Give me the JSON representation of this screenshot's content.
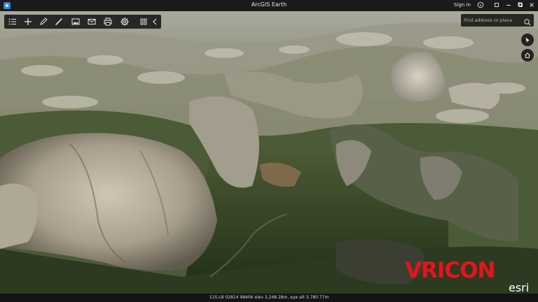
{
  "window": {
    "title": "ArcGIS Earth",
    "sign_in": "Sign in",
    "icons": [
      "help-icon",
      "minimize-icon",
      "maximize-icon",
      "close-icon"
    ]
  },
  "toolbar": {
    "items": [
      "contents-icon",
      "add-icon",
      "draw-icon",
      "measure-icon",
      "screenshot-icon",
      "email-icon",
      "print-icon",
      "settings-icon",
      "basemap-icon",
      "collapse-icon"
    ]
  },
  "search": {
    "placeholder": "Find address or place"
  },
  "nav": {
    "items": [
      "navigate-icon",
      "home-icon"
    ]
  },
  "status": {
    "coordinates": "11S LB 02814 98406   elev 3,248.28m,   eye alt 3,780.77m"
  },
  "logos": {
    "vricon": "VRICON",
    "esri": "esri"
  },
  "colors": {
    "accent": "#2f86d6",
    "vricon_red": "#e5141c",
    "toolbar_bg": "#161616"
  }
}
